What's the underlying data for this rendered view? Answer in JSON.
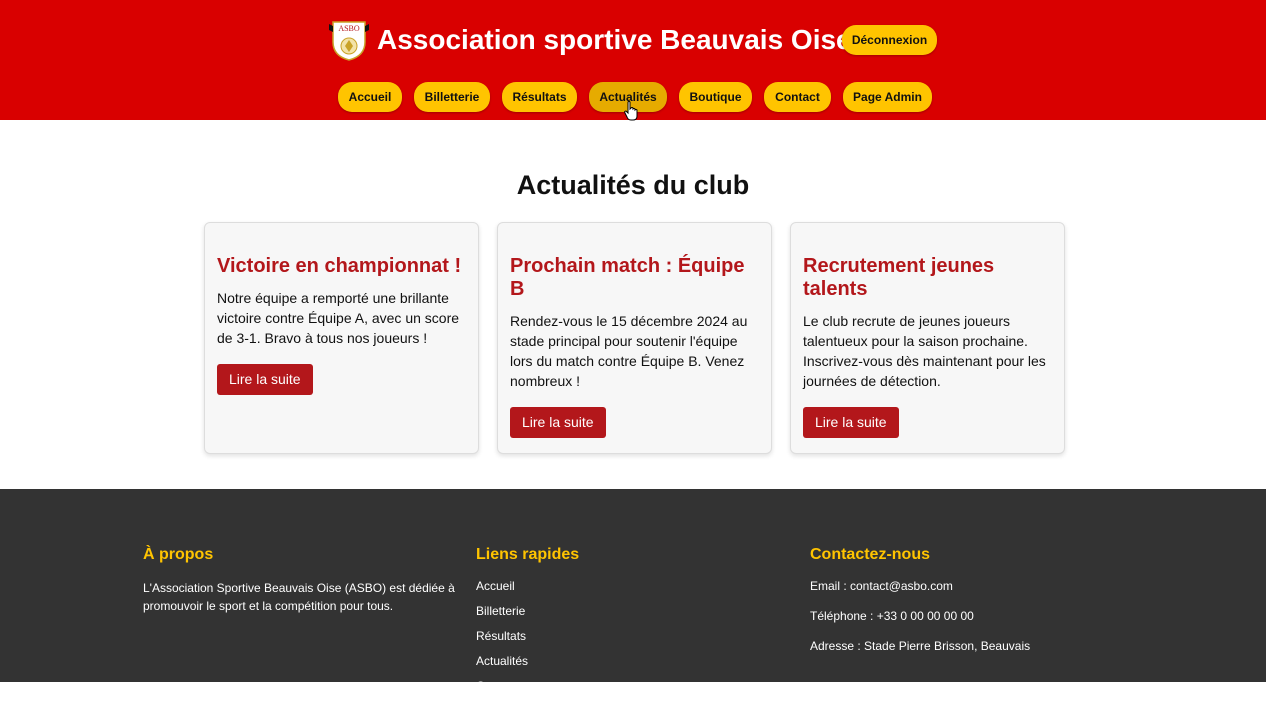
{
  "header": {
    "title": "Association sportive Beauvais Oise",
    "logo_text": "ASBO",
    "logout_label": "Déconnexion",
    "nav": [
      "Accueil",
      "Billetterie",
      "Résultats",
      "Actualités",
      "Boutique",
      "Contact",
      "Page Admin"
    ],
    "active_nav": "Actualités"
  },
  "main": {
    "title": "Actualités du club",
    "cards": [
      {
        "title": "Victoire en championnat !",
        "text": "Notre équipe a remporté une brillante victoire contre Équipe A, avec un score de 3-1. Bravo à tous nos joueurs !",
        "button": "Lire la suite"
      },
      {
        "title": "Prochain match : Équipe B",
        "text": "Rendez-vous le 15 décembre 2024 au stade principal pour soutenir l'équipe lors du match contre Équipe B. Venez nombreux !",
        "button": "Lire la suite"
      },
      {
        "title": "Recrutement jeunes talents",
        "text": "Le club recrute de jeunes joueurs talentueux pour la saison prochaine. Inscrivez-vous dès maintenant pour les journées de détection.",
        "button": "Lire la suite"
      }
    ]
  },
  "footer": {
    "about": {
      "title": "À propos",
      "text": "L'Association Sportive Beauvais Oise (ASBO) est dédiée à promouvoir le sport et la compétition pour tous."
    },
    "links": {
      "title": "Liens rapides",
      "items": [
        "Accueil",
        "Billetterie",
        "Résultats",
        "Actualités",
        "Contact"
      ]
    },
    "contact": {
      "title": "Contactez-nous",
      "email": "Email : contact@asbo.com",
      "phone": "Téléphone : +33 0 00 00 00 00",
      "address": "Adresse : Stade Pierre Brisson, Beauvais"
    }
  },
  "colors": {
    "header_bg": "#d90000",
    "accent_yellow": "#ffc400",
    "card_title": "#b3171b",
    "footer_bg": "#333333"
  }
}
